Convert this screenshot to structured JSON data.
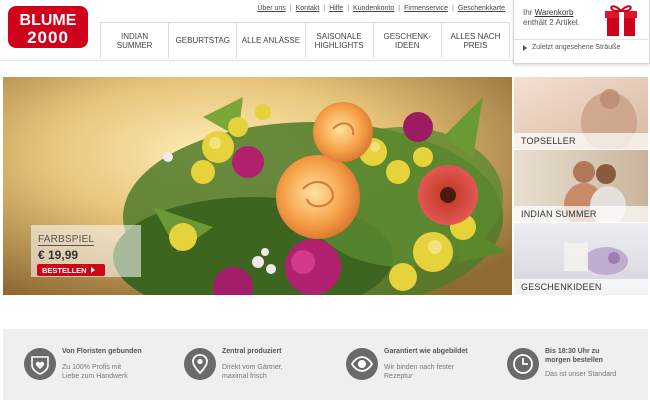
{
  "logo": {
    "line1": "BLUME",
    "line2": "2000"
  },
  "topnav": [
    "Über uns",
    "Kontakt",
    "Hilfe",
    "Kundenkonto",
    "Firmenservice",
    "Geschenkkarte"
  ],
  "mainnav": [
    {
      "line1": "INDIAN",
      "line2": "SUMMER"
    },
    {
      "line1": "GEBURTSTAG",
      "line2": ""
    },
    {
      "line1": "ALLE ANLÄSSE",
      "line2": ""
    },
    {
      "line1": "SAISONALE",
      "line2": "HIGHLIGHTS"
    },
    {
      "line1": "GESCHENK-",
      "line2": "IDEEN"
    },
    {
      "line1": "ALLES NACH",
      "line2": "PREIS"
    }
  ],
  "cart": {
    "prefix": "Ihr ",
    "link": "Warenkorb",
    "line2": "enthält 2 Artikel.",
    "recent": "Zuletzt angesehene Sträuße"
  },
  "hero": {
    "product": "FARBSPIEL",
    "price": "€ 19,99",
    "button": "BESTELLEN"
  },
  "tiles": [
    "TOPSELLER",
    "INDIAN SUMMER",
    "GESCHENKIDEEN"
  ],
  "features": [
    {
      "icon": "heart-icon",
      "title": "Von Floristen gebunden",
      "desc1": "Zu 100% Profis mit",
      "desc2": "Liebe zum Handwerk"
    },
    {
      "icon": "location-pin-icon",
      "title": "Zentral produziert",
      "desc1": "Direkt vom Gärtner,",
      "desc2": "maximal frisch"
    },
    {
      "icon": "eye-icon",
      "title": "Garantiert wie abgebildet",
      "desc1": "Wir binden nach fester",
      "desc2": "Rezeptur"
    },
    {
      "icon": "clock-icon",
      "title": "Bis 18:30 Uhr zu",
      "title2": "morgen bestellen",
      "desc1": "Das ist unser Standard",
      "desc2": ""
    }
  ],
  "colors": {
    "brand_red": "#cc0718",
    "icon_gray": "#6a6a6a",
    "feature_bg": "#efefef"
  }
}
